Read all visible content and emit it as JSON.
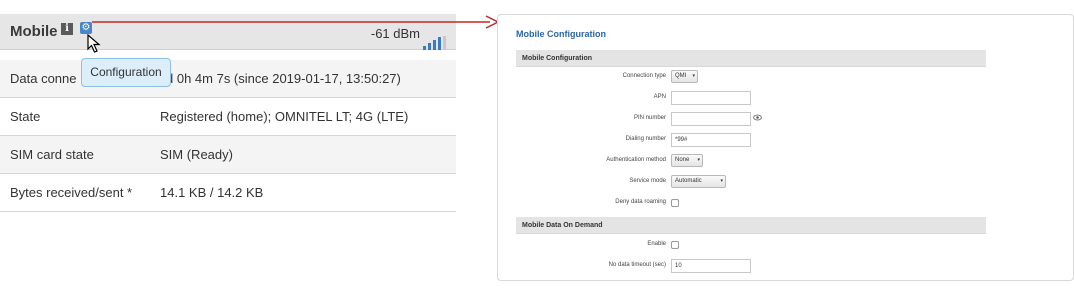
{
  "status": {
    "title": "Mobile",
    "signal": "-61 dBm",
    "tooltip": "Configuration",
    "rows": [
      {
        "label": "Data connection",
        "label_visible": "Data conne",
        "value": "d 0h 4m 7s (since 2019-01-17, 13:50:27)"
      },
      {
        "label": "State",
        "value": "Registered (home); OMNITEL LT; 4G (LTE)"
      },
      {
        "label": "SIM card state",
        "value": "SIM (Ready)"
      },
      {
        "label": "Bytes received/sent *",
        "value": "14.1 KB / 14.2 KB"
      }
    ]
  },
  "config": {
    "title": "Mobile Configuration",
    "section1": "Mobile Configuration",
    "connection_type": {
      "label": "Connection type",
      "value": "QMI"
    },
    "apn": {
      "label": "APN",
      "value": ""
    },
    "pin": {
      "label": "PIN number",
      "value": ""
    },
    "dialing": {
      "label": "Dialing number",
      "value": "*99#"
    },
    "auth": {
      "label": "Authentication method",
      "value": "None"
    },
    "service_mode": {
      "label": "Service mode",
      "value": "Automatic"
    },
    "deny_roaming": {
      "label": "Deny data roaming",
      "checked": false
    },
    "section2": "Mobile Data On Demand",
    "enable": {
      "label": "Enable",
      "checked": false
    },
    "timeout": {
      "label": "No data timeout (sec)",
      "value": "10"
    }
  },
  "colors": {
    "accent": "#2b65a8",
    "arrow": "#c0282d",
    "signal": "#3b7bc4"
  }
}
